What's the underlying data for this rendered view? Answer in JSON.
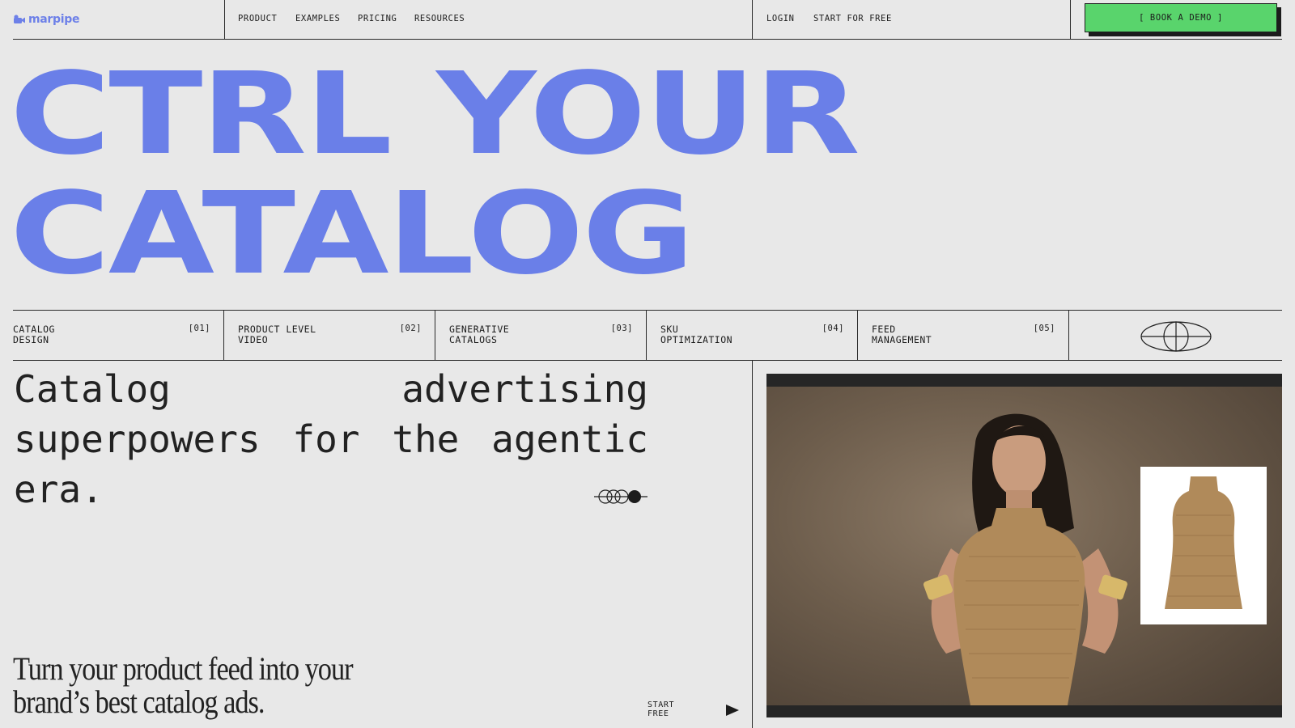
{
  "brand": {
    "name": "marpipe",
    "accent": "#6a7fe8"
  },
  "nav": {
    "links": [
      "PRODUCT",
      "EXAMPLES",
      "PRICING",
      "RESOURCES"
    ],
    "login": "LOGIN",
    "start": "START FOR FREE",
    "demo": "[ BOOK A DEMO ]",
    "demo_color": "#59d46c"
  },
  "hero": {
    "line1": "CTRL YOUR",
    "line2": "CATALOG"
  },
  "features": [
    {
      "label": "CATALOG\nDESIGN",
      "num": "[01]"
    },
    {
      "label": "PRODUCT LEVEL\nVIDEO",
      "num": "[02]"
    },
    {
      "label": "GENERATIVE\nCATALOGS",
      "num": "[03]"
    },
    {
      "label": "SKU\nOPTIMIZATION",
      "num": "[04]"
    },
    {
      "label": "FEED\nMANAGEMENT",
      "num": "[05]"
    }
  ],
  "tagline": "Catalog advertising superpowers for the agentic era.",
  "subcopy": "Turn your product feed into your brand’s best catalog ads.",
  "cta": {
    "start_free": "START\nFREE"
  },
  "icons": {
    "logo": "marpipe-logo-icon",
    "globe": "globe-icon",
    "rings": "rings-icon",
    "play": "play-icon"
  }
}
